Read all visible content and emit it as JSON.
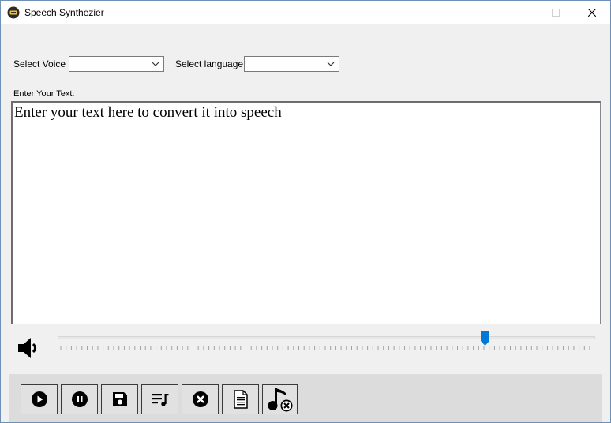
{
  "window": {
    "title": "Speech Synthezier"
  },
  "voice": {
    "label": "Select Voice",
    "value": ""
  },
  "language": {
    "label": "Select language",
    "value": ""
  },
  "text_input": {
    "label": "Enter Your Text:",
    "value": "Enter your text here to convert it into speech"
  },
  "volume": {
    "level": 0.8
  },
  "toolbar": {
    "buttons": [
      {
        "name": "play-button",
        "icon": "play-circle-icon"
      },
      {
        "name": "pause-button",
        "icon": "pause-circle-icon"
      },
      {
        "name": "save-button",
        "icon": "floppy-disk-icon"
      },
      {
        "name": "playlist-button",
        "icon": "playlist-music-icon"
      },
      {
        "name": "stop-button",
        "icon": "close-circle-icon"
      },
      {
        "name": "document-button",
        "icon": "document-icon"
      },
      {
        "name": "music-off-button",
        "icon": "music-note-off-icon"
      }
    ]
  }
}
